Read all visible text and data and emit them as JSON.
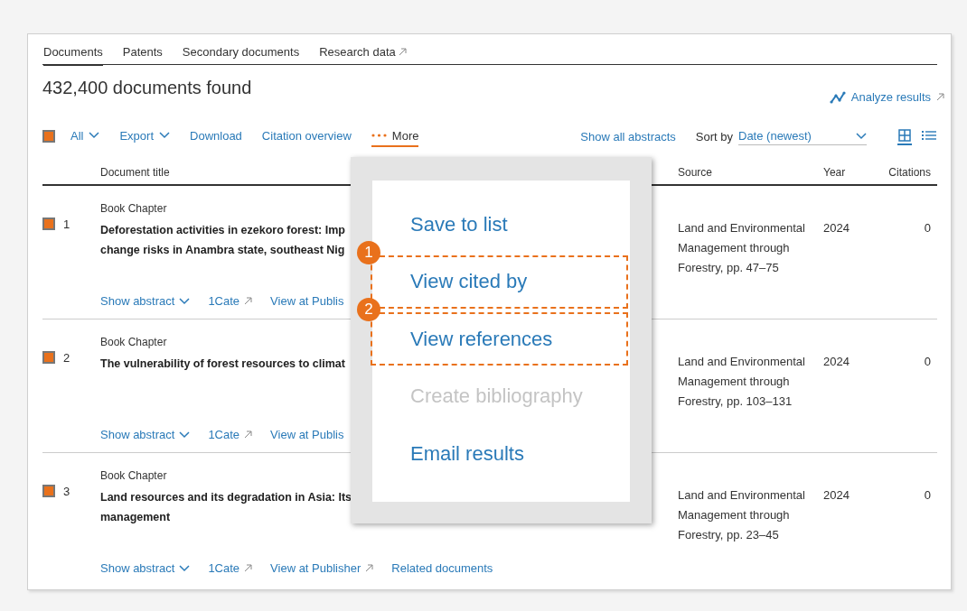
{
  "tabs": [
    {
      "label": "Documents",
      "selected": true,
      "external": false
    },
    {
      "label": "Patents",
      "selected": false,
      "external": false
    },
    {
      "label": "Secondary documents",
      "selected": false,
      "external": false
    },
    {
      "label": "Research data",
      "selected": false,
      "external": true
    }
  ],
  "results_heading": "432,400 documents found",
  "analyze_link": "Analyze results",
  "toolbar": {
    "select_all_checked": true,
    "items": [
      {
        "label": "All",
        "kind": "dropdown",
        "selected": false
      },
      {
        "label": "Export",
        "kind": "dropdown",
        "selected": false
      },
      {
        "label": "Download",
        "kind": "link",
        "selected": false
      },
      {
        "label": "Citation overview",
        "kind": "link",
        "selected": false
      },
      {
        "label": "More",
        "kind": "more",
        "selected": true
      }
    ],
    "show_all_abstracts": "Show all abstracts",
    "sort_label": "Sort by",
    "sort_value": "Date (newest)",
    "views": [
      {
        "kind": "grid",
        "selected": true
      },
      {
        "kind": "list",
        "selected": false
      }
    ]
  },
  "table": {
    "columns": [
      "Document title",
      "Source",
      "Year",
      "Citations"
    ],
    "rows": [
      {
        "checked": true,
        "number": "1",
        "type": "Book Chapter",
        "title_lines": [
          "Deforestation activities in ezekoro forest: Imp",
          "change risks in Anambra state, southeast Nig"
        ],
        "links": [
          {
            "label": "Show abstract",
            "kind": "expand"
          },
          {
            "label": "1Cate",
            "kind": "external"
          },
          {
            "label": "View at Publis",
            "kind": "plain"
          }
        ],
        "source_lines": [
          "Land and Environmental",
          "Management through",
          "Forestry, pp. 47–75"
        ],
        "year": "2024",
        "citations": "0"
      },
      {
        "checked": true,
        "number": "2",
        "type": "Book Chapter",
        "title_lines": [
          "The vulnerability of forest resources to climat"
        ],
        "links": [
          {
            "label": "Show abstract",
            "kind": "expand"
          },
          {
            "label": "1Cate",
            "kind": "external"
          },
          {
            "label": "View at Publis",
            "kind": "plain"
          }
        ],
        "source_lines": [
          "Land and Environmental",
          "Management through",
          "Forestry, pp. 103–131"
        ],
        "year": "2024",
        "citations": "0"
      },
      {
        "checked": true,
        "number": "3",
        "type": "Book Chapter",
        "title_lines": [
          "Land resources and its degradation in Asia: Its",
          "management"
        ],
        "links": [
          {
            "label": "Show abstract",
            "kind": "expand"
          },
          {
            "label": "1Cate",
            "kind": "external"
          },
          {
            "label": "View at Publisher",
            "kind": "external"
          },
          {
            "label": "Related documents",
            "kind": "plain"
          }
        ],
        "source_lines": [
          "Land and Environmental",
          "Management through",
          "Forestry, pp. 23–45"
        ],
        "year": "2024",
        "citations": "0"
      }
    ]
  },
  "more_menu": {
    "items": [
      {
        "label": "Save to list",
        "disabled": false
      },
      {
        "label": "View cited by",
        "disabled": false,
        "callout": "1"
      },
      {
        "label": "View references",
        "disabled": false,
        "callout": "2"
      },
      {
        "label": "Create bibliography",
        "disabled": true
      },
      {
        "label": "Email results",
        "disabled": false
      }
    ]
  }
}
